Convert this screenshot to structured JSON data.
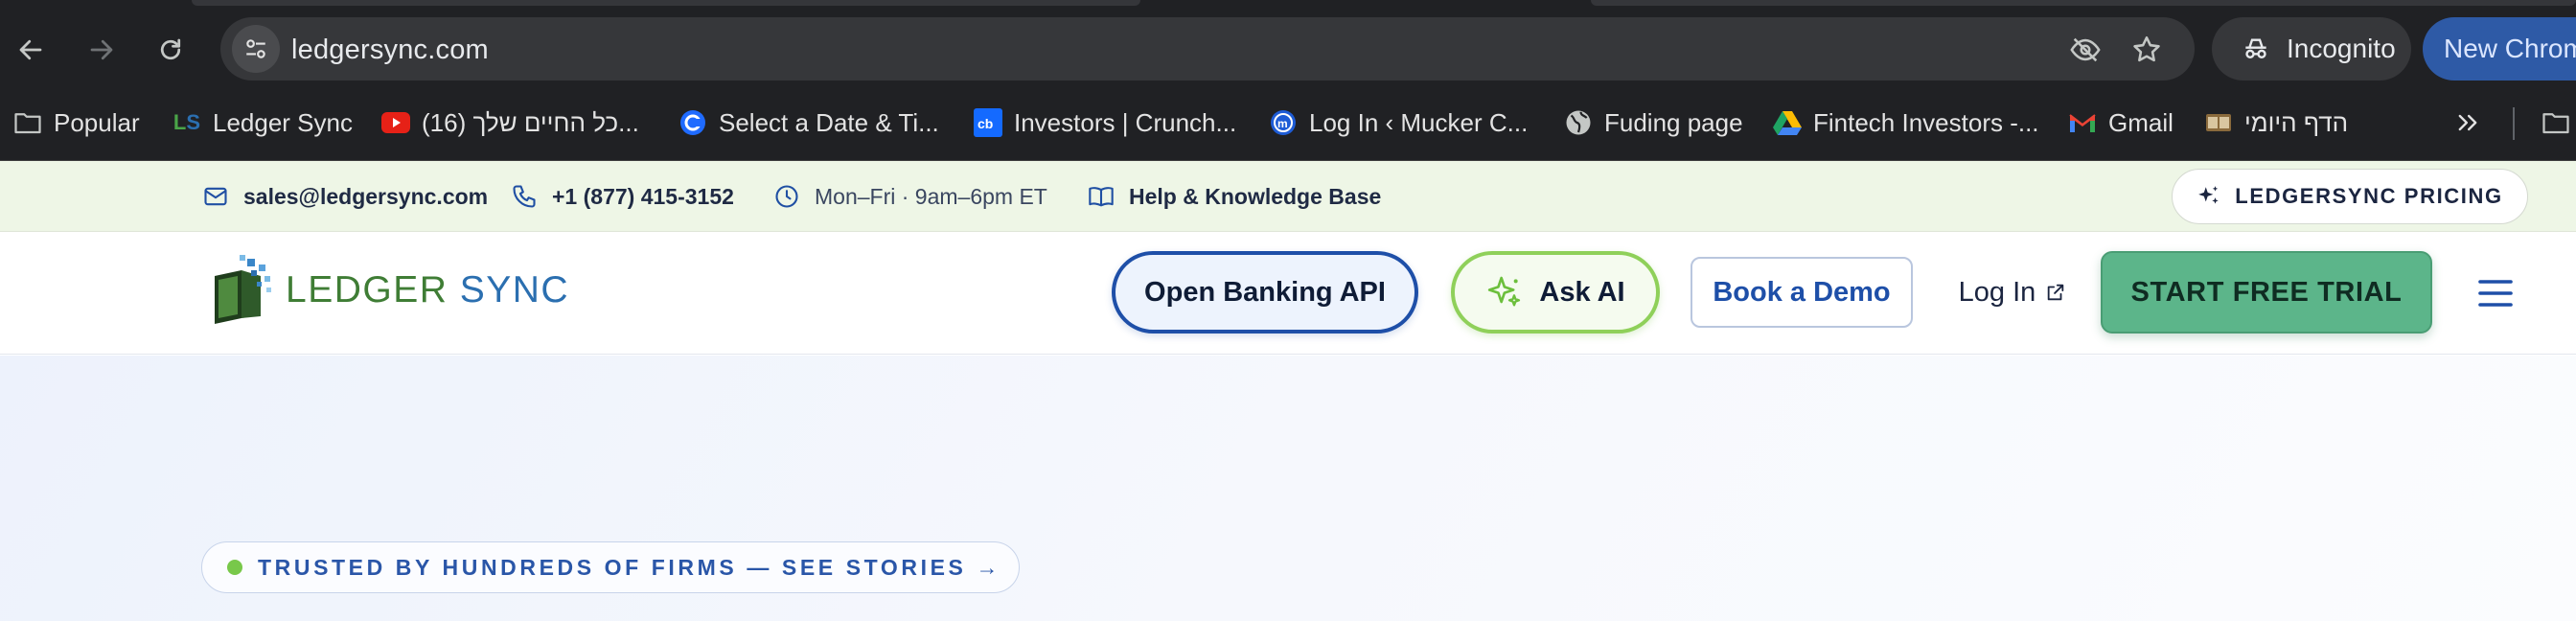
{
  "browser": {
    "url": "ledgersync.com",
    "incognito_label": "Incognito",
    "new_chrome_label": "New Chrom",
    "bookmarks": [
      {
        "label": "Popular",
        "icon": "folder-icon"
      },
      {
        "label": "Ledger Sync",
        "icon": "ledgersync-favicon"
      },
      {
        "label": "(16) כל החיים שלך...",
        "icon": "youtube-icon"
      },
      {
        "label": "Select a Date & Ti...",
        "icon": "calendly-icon"
      },
      {
        "label": "Investors | Crunch...",
        "icon": "crunchbase-icon"
      },
      {
        "label": "Log In ‹ Mucker C...",
        "icon": "mucker-icon"
      },
      {
        "label": "Fuding page",
        "icon": "globe-icon"
      },
      {
        "label": "Fintech Investors -...",
        "icon": "google-drive-icon"
      },
      {
        "label": "Gmail",
        "icon": "gmail-icon"
      },
      {
        "label": "הדף היומי",
        "icon": "daf-icon"
      }
    ]
  },
  "topbar": {
    "email": "sales@ledgersync.com",
    "phone": "+1 (877) 415-3152",
    "hours": "Mon–Fri · 9am–6pm ET",
    "help": "Help & Knowledge Base",
    "pricing": "LEDGERSYNC PRICING"
  },
  "header": {
    "logo_text_1": "LEDGER",
    "logo_text_2": "SYNC",
    "open_banking": "Open Banking API",
    "ask_ai": "Ask AI",
    "book_demo": "Book a Demo",
    "login": "Log In",
    "trial": "START FREE TRIAL"
  },
  "hero": {
    "trusted": "TRUSTED BY HUNDREDS OF FIRMS — SEE STORIES →"
  },
  "colors": {
    "accent_blue": "#1e4fa8",
    "accent_green": "#5cb58a",
    "topbar_bg": "#eef6e6"
  }
}
